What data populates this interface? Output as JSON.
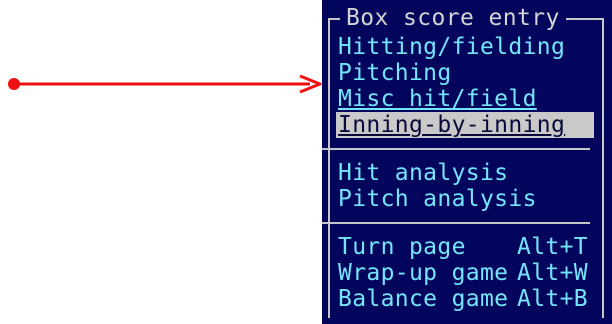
{
  "colors": {
    "panel_background": "#02055c",
    "menu_text": "#75e4ff",
    "title_text": "#d3d3d3",
    "highlight_background": "#c9c9c9",
    "highlight_text": "#0a0a3a",
    "pointer": "#ee1111"
  },
  "menu": {
    "title": "Box score entry",
    "items": [
      {
        "label": "Hitting/fielding",
        "shortcut": ""
      },
      {
        "label": "Pitching",
        "shortcut": ""
      },
      {
        "label": "Misc hit/field",
        "shortcut": ""
      },
      {
        "label": "Inning-by-inning",
        "shortcut": ""
      },
      {
        "label": "Hit analysis",
        "shortcut": ""
      },
      {
        "label": "Pitch analysis",
        "shortcut": ""
      },
      {
        "label": "Turn page",
        "shortcut": "Alt+T"
      },
      {
        "label": "Wrap-up game",
        "shortcut": "Alt+W"
      },
      {
        "label": "Balance game",
        "shortcut": "Alt+B"
      }
    ],
    "selected_item": "Inning-by-inning"
  },
  "pointer": {
    "icon": "red-arrow-pointer-icon"
  }
}
